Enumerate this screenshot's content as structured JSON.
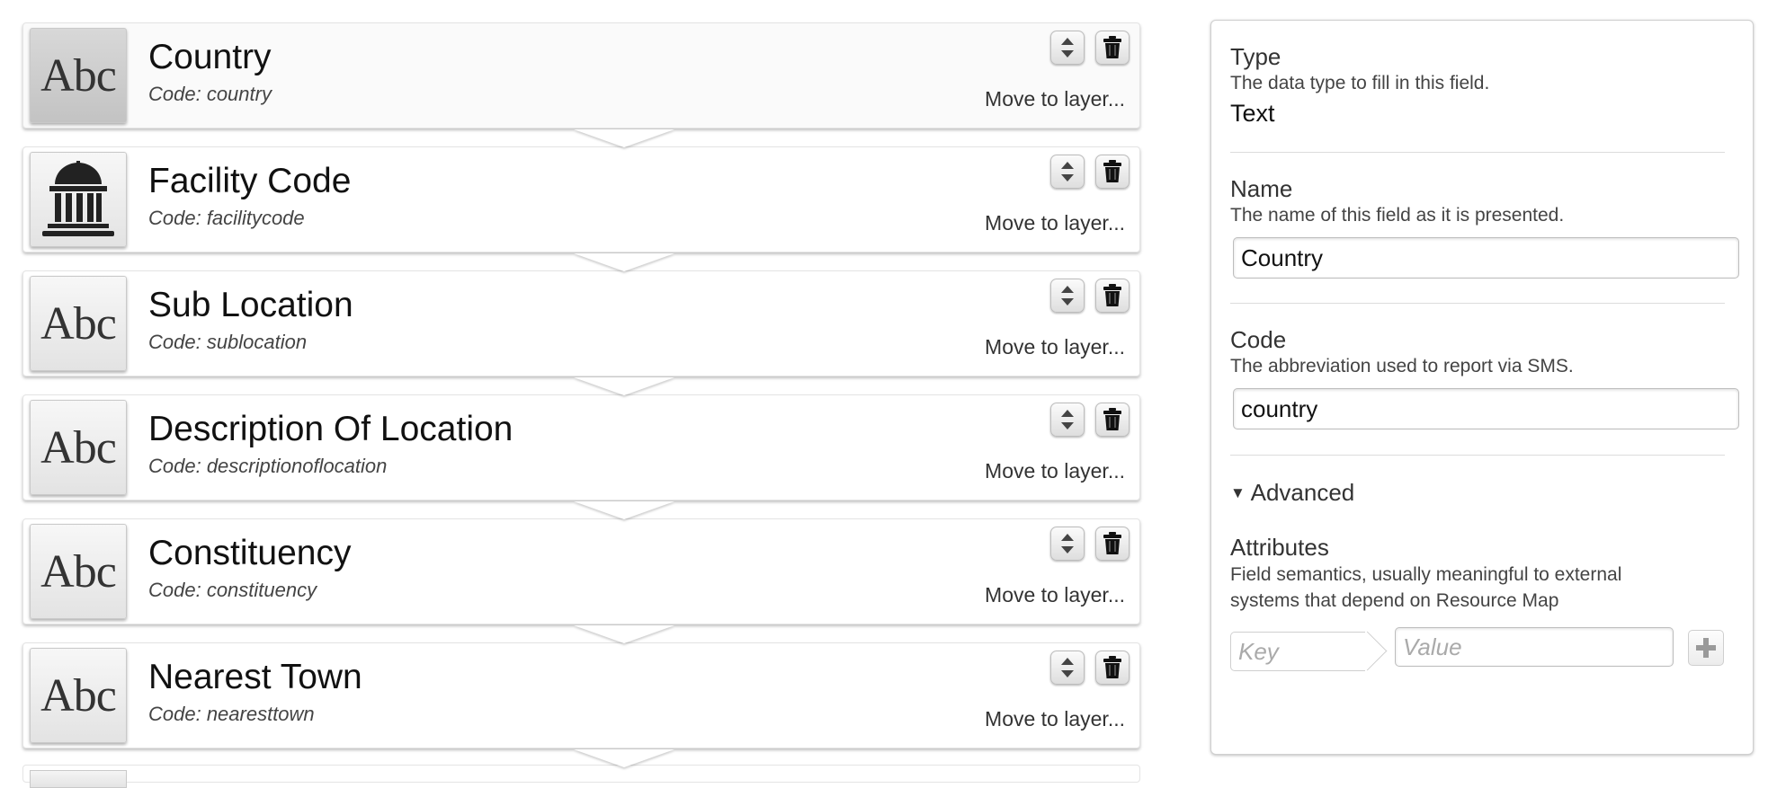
{
  "fields": [
    {
      "name": "Country",
      "code": "Code: country",
      "icon": "abc-text-icon",
      "glyph": "Abc",
      "selected": true
    },
    {
      "name": "Facility Code",
      "code": "Code: facilitycode",
      "icon": "facility-building-icon",
      "glyph": "",
      "selected": false
    },
    {
      "name": "Sub Location",
      "code": "Code: sublocation",
      "icon": "abc-text-icon",
      "glyph": "Abc",
      "selected": false
    },
    {
      "name": "Description Of Location",
      "code": "Code: descriptionoflocation",
      "icon": "abc-text-icon",
      "glyph": "Abc",
      "selected": false
    },
    {
      "name": "Constituency",
      "code": "Code: constituency",
      "icon": "abc-text-icon",
      "glyph": "Abc",
      "selected": false
    },
    {
      "name": "Nearest Town",
      "code": "Code: nearesttown",
      "icon": "abc-text-icon",
      "glyph": "Abc",
      "selected": false
    }
  ],
  "row_actions": {
    "move_label": "Move to layer...",
    "updown_icon": "up-down-arrows-icon",
    "trash_icon": "trash-icon"
  },
  "panel": {
    "type": {
      "title": "Type",
      "description": "The data type to fill in this field.",
      "value": "Text"
    },
    "name": {
      "title": "Name",
      "description": "The name of this field as it is presented.",
      "value": "Country"
    },
    "code": {
      "title": "Code",
      "description": "The abbreviation used to report via SMS.",
      "value": "country"
    },
    "advanced": {
      "label": "Advanced",
      "expanded": true,
      "toggle_glyph": "▼"
    },
    "attributes": {
      "title": "Attributes",
      "description_line1": "Field semantics, usually meaningful to external",
      "description_line2": "systems that depend on Resource Map",
      "key_placeholder": "Key",
      "value_placeholder": "Value",
      "add_icon": "plus-icon"
    }
  }
}
